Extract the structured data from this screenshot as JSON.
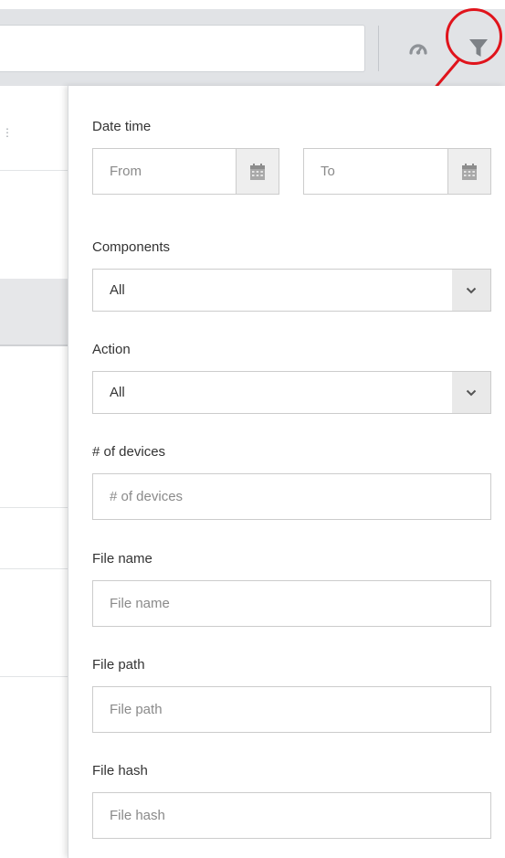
{
  "header": {
    "search_value": "",
    "gauge_icon": "gauge-icon",
    "filter_icon": "filter-icon",
    "annotation_color": "#e0141c"
  },
  "filter": {
    "date_time": {
      "label": "Date time",
      "from_placeholder": "From",
      "to_placeholder": "To",
      "calendar_icon": "calendar-icon"
    },
    "components": {
      "label": "Components",
      "value": "All"
    },
    "action": {
      "label": "Action",
      "value": "All"
    },
    "devices": {
      "label": "# of devices",
      "placeholder": "# of devices"
    },
    "file_name": {
      "label": "File name",
      "placeholder": "File name"
    },
    "file_path": {
      "label": "File path",
      "placeholder": "File path"
    },
    "file_hash": {
      "label": "File hash",
      "placeholder": "File hash"
    }
  }
}
